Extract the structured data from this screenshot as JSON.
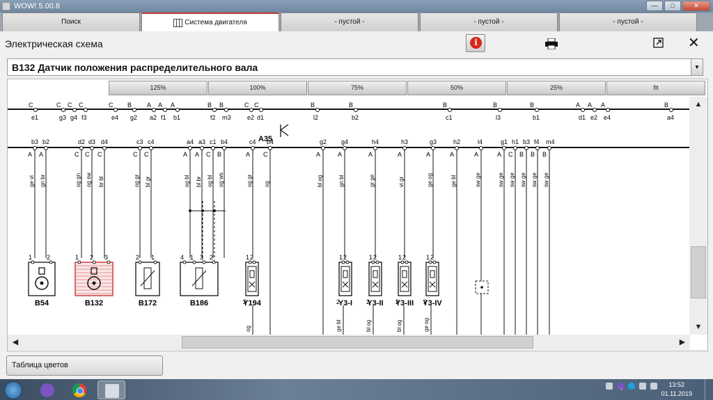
{
  "window": {
    "title": "WOW! 5.00.8",
    "btn_min": "—",
    "btn_max": "□",
    "btn_close": "✕"
  },
  "tabs": [
    {
      "label": "Поиск",
      "icon": ""
    },
    {
      "label": "Система двигателя",
      "icon": "schematic-icon",
      "active": true
    },
    {
      "label": "-  пустой  -"
    },
    {
      "label": "-  пустой  -"
    },
    {
      "label": "-  пустой  -"
    }
  ],
  "header": {
    "title": "Электрическая схема",
    "info_label": "i"
  },
  "component_select": {
    "value": "B132  Датчик положения распределительного вала",
    "arrow": "▼"
  },
  "zoom_levels": [
    "125%",
    "100%",
    "75%",
    "50%",
    "25%",
    "fit"
  ],
  "scroll": {
    "up": "▲",
    "down": "▼",
    "left": "◀",
    "right": "▶"
  },
  "color_table_button": "Таблица цветов",
  "taskbar": {
    "time": "13:52",
    "date": "01.11.2019"
  },
  "colors": {
    "selected_component": "#d23c3c",
    "error_icon": "#d9261c",
    "tab_accent": "#c0392b"
  },
  "schematic": {
    "top_bus": {
      "pins": [
        {
          "name": "e1",
          "pin": "C"
        },
        {
          "name": "g3",
          "pin": "C"
        },
        {
          "name": "g4",
          "pin": "C"
        },
        {
          "name": "f3",
          "pin": "C"
        },
        {
          "name": "e4",
          "pin": "C"
        },
        {
          "name": "g2",
          "pin": "B"
        },
        {
          "name": "a2",
          "pin": "A"
        },
        {
          "name": "f1",
          "pin": "A"
        },
        {
          "name": "b1",
          "pin": "A"
        },
        {
          "name": "f2",
          "pin": "B"
        },
        {
          "name": "m3",
          "pin": "B"
        },
        {
          "name": "e2",
          "pin": "C"
        },
        {
          "name": "d1",
          "pin": "C"
        },
        {
          "name": "l2",
          "pin": "B"
        },
        {
          "name": "b2",
          "pin": "B"
        },
        {
          "name": "c1",
          "pin": "B"
        },
        {
          "name": "l3",
          "pin": "B"
        },
        {
          "name": "b1",
          "pin": "B"
        },
        {
          "name": "d1",
          "pin": "A"
        },
        {
          "name": "e2",
          "pin": "A"
        },
        {
          "name": "e4",
          "pin": "A"
        },
        {
          "name": "a4",
          "pin": "B"
        }
      ]
    },
    "module_label": "A35",
    "bottom_bus": {
      "pins": [
        {
          "name": "b3",
          "pin": "A"
        },
        {
          "name": "b2",
          "pin": "A"
        },
        {
          "name": "d2",
          "pin": "C"
        },
        {
          "name": "d3",
          "pin": "C"
        },
        {
          "name": "d4",
          "pin": "C"
        },
        {
          "name": "c3",
          "pin": "C"
        },
        {
          "name": "c4",
          "pin": "C"
        },
        {
          "name": "a4",
          "pin": "A"
        },
        {
          "name": "a3",
          "pin": "A"
        },
        {
          "name": "c1",
          "pin": "C"
        },
        {
          "name": "b4",
          "pin": "B"
        },
        {
          "name": "c4",
          "pin": "A"
        },
        {
          "name": "b4",
          "pin": "C"
        },
        {
          "name": "g2",
          "pin": "A"
        },
        {
          "name": "g4",
          "pin": "A"
        },
        {
          "name": "h4",
          "pin": "A"
        },
        {
          "name": "h3",
          "pin": "A"
        },
        {
          "name": "g3",
          "pin": "A"
        },
        {
          "name": "h2",
          "pin": "A"
        },
        {
          "name": "l4",
          "pin": "A"
        },
        {
          "name": "g1",
          "pin": "A"
        },
        {
          "name": "h1",
          "pin": "C"
        },
        {
          "name": "b3",
          "pin": "B"
        },
        {
          "name": "f4",
          "pin": "B"
        },
        {
          "name": "m4",
          "pin": "B"
        }
      ]
    },
    "wire_colors": [
      "ge vi",
      "gn br",
      "og gn",
      "og sw",
      "br bl",
      "og gr",
      "bl gr",
      "og bl",
      "bl br",
      "og bl",
      "og ws",
      "og gr",
      "og",
      "bl og",
      "gn bl",
      "gr ge",
      "vi gr",
      "ge og",
      "ge bl",
      "sw ge",
      "sw ge",
      "sw ge",
      "sw ge",
      "sw ge",
      "sw ge"
    ],
    "lower_wire_colors": [
      "og",
      "ge bl",
      "bl og",
      "bl og",
      "ge og"
    ],
    "components": [
      {
        "name": "B54",
        "pins": [
          "1",
          "2"
        ]
      },
      {
        "name": "B132",
        "pins": [
          "1",
          "2",
          "3"
        ],
        "selected": true
      },
      {
        "name": "B172",
        "pins": [
          "2",
          "1"
        ]
      },
      {
        "name": "B186",
        "pins": [
          "4",
          "1",
          "3",
          "2"
        ]
      },
      {
        "name": "Y194",
        "pins": [
          "1",
          "2"
        ]
      },
      {
        "name": "Y3-I",
        "pins": [
          "1",
          "2"
        ]
      },
      {
        "name": "Y3-II",
        "pins": [
          "1",
          "2"
        ]
      },
      {
        "name": "Y3-III",
        "pins": [
          "1",
          "2"
        ]
      },
      {
        "name": "Y3-IV",
        "pins": [
          "1",
          "2"
        ]
      }
    ]
  }
}
